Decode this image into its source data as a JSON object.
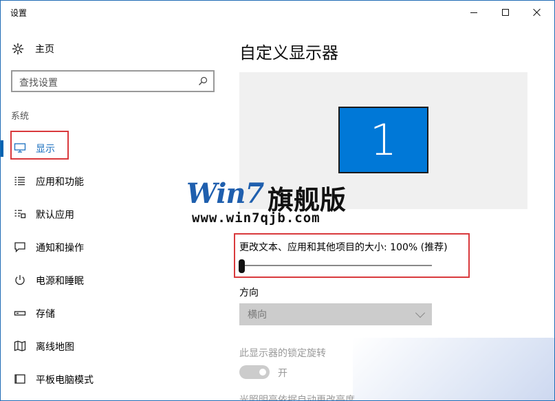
{
  "window": {
    "title": "设置",
    "controls": {
      "minimize": "minimize",
      "maximize": "maximize",
      "close": "close"
    }
  },
  "sidebar": {
    "home_label": "主页",
    "search_placeholder": "查找设置",
    "section_label": "系统",
    "items": [
      {
        "label": "显示",
        "icon": "monitor-icon",
        "active": true
      },
      {
        "label": "应用和功能",
        "icon": "list-icon"
      },
      {
        "label": "默认应用",
        "icon": "default-apps-icon"
      },
      {
        "label": "通知和操作",
        "icon": "notification-icon"
      },
      {
        "label": "电源和睡眠",
        "icon": "power-icon"
      },
      {
        "label": "存储",
        "icon": "storage-icon"
      },
      {
        "label": "离线地图",
        "icon": "map-icon"
      },
      {
        "label": "平板电脑模式",
        "icon": "tablet-icon"
      }
    ]
  },
  "main": {
    "title": "自定义显示器",
    "monitor_number": "1",
    "scale_label": "更改文本、应用和其他项目的大小: 100% (推荐)",
    "scale_value_percent": 0,
    "orientation_label": "方向",
    "orientation_value": "横向",
    "lock_rotation_label": "此显示器的锁定旋转",
    "lock_rotation_state": "开",
    "brightness_label": "光照明亮依据自动更改亮度"
  },
  "watermark": {
    "brand": "Win7",
    "brand_cn": "旗舰版",
    "url": "www.win7qjb.com"
  },
  "colors": {
    "accent": "#0078d7",
    "active_text": "#1a6fbf",
    "highlight_box": "#d9393c",
    "watermark_blue": "#1f5fae"
  }
}
